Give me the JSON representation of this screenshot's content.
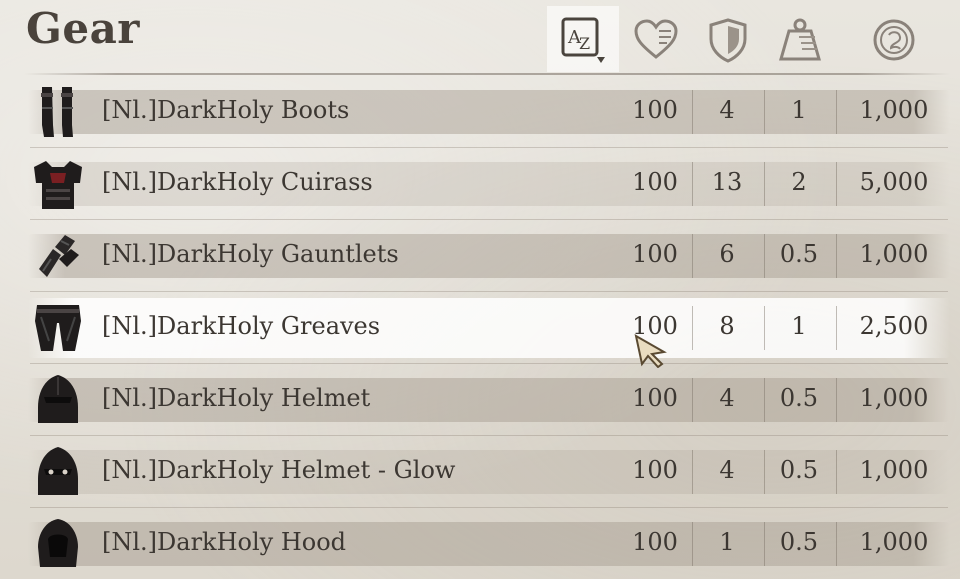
{
  "header": {
    "title": "Gear",
    "columns": [
      {
        "key": "sort",
        "icon": "sort-az-icon",
        "active": true
      },
      {
        "key": "health",
        "icon": "heart-icon"
      },
      {
        "key": "armor",
        "icon": "shield-icon"
      },
      {
        "key": "weight",
        "icon": "weight-icon"
      },
      {
        "key": "value",
        "icon": "coin-icon"
      }
    ]
  },
  "items": [
    {
      "name": "[Nl.]DarkHoly Boots",
      "c1": "100",
      "c2": "4",
      "c3": "1",
      "value": "1,000",
      "icon": "boots-icon"
    },
    {
      "name": "[Nl.]DarkHoly Cuirass",
      "c1": "100",
      "c2": "13",
      "c3": "2",
      "value": "5,000",
      "icon": "cuirass-icon"
    },
    {
      "name": "[Nl.]DarkHoly Gauntlets",
      "c1": "100",
      "c2": "6",
      "c3": "0.5",
      "value": "1,000",
      "icon": "gauntlets-icon"
    },
    {
      "name": "[Nl.]DarkHoly Greaves",
      "c1": "100",
      "c2": "8",
      "c3": "1",
      "value": "2,500",
      "icon": "greaves-icon"
    },
    {
      "name": "[Nl.]DarkHoly Helmet",
      "c1": "100",
      "c2": "4",
      "c3": "0.5",
      "value": "1,000",
      "icon": "helmet-icon"
    },
    {
      "name": "[Nl.]DarkHoly Helmet - Glow",
      "c1": "100",
      "c2": "4",
      "c3": "0.5",
      "value": "1,000",
      "icon": "helmet-glow-icon"
    },
    {
      "name": "[Nl.]DarkHoly Hood",
      "c1": "100",
      "c2": "1",
      "c3": "0.5",
      "value": "1,000",
      "icon": "hood-icon"
    }
  ],
  "selected_index": 3,
  "colors": {
    "text": "#3c3732",
    "title": "#4a433c",
    "icon_outline": "#5a544d",
    "item_dark": "#1e1c1c",
    "item_red": "#7a1f22"
  }
}
